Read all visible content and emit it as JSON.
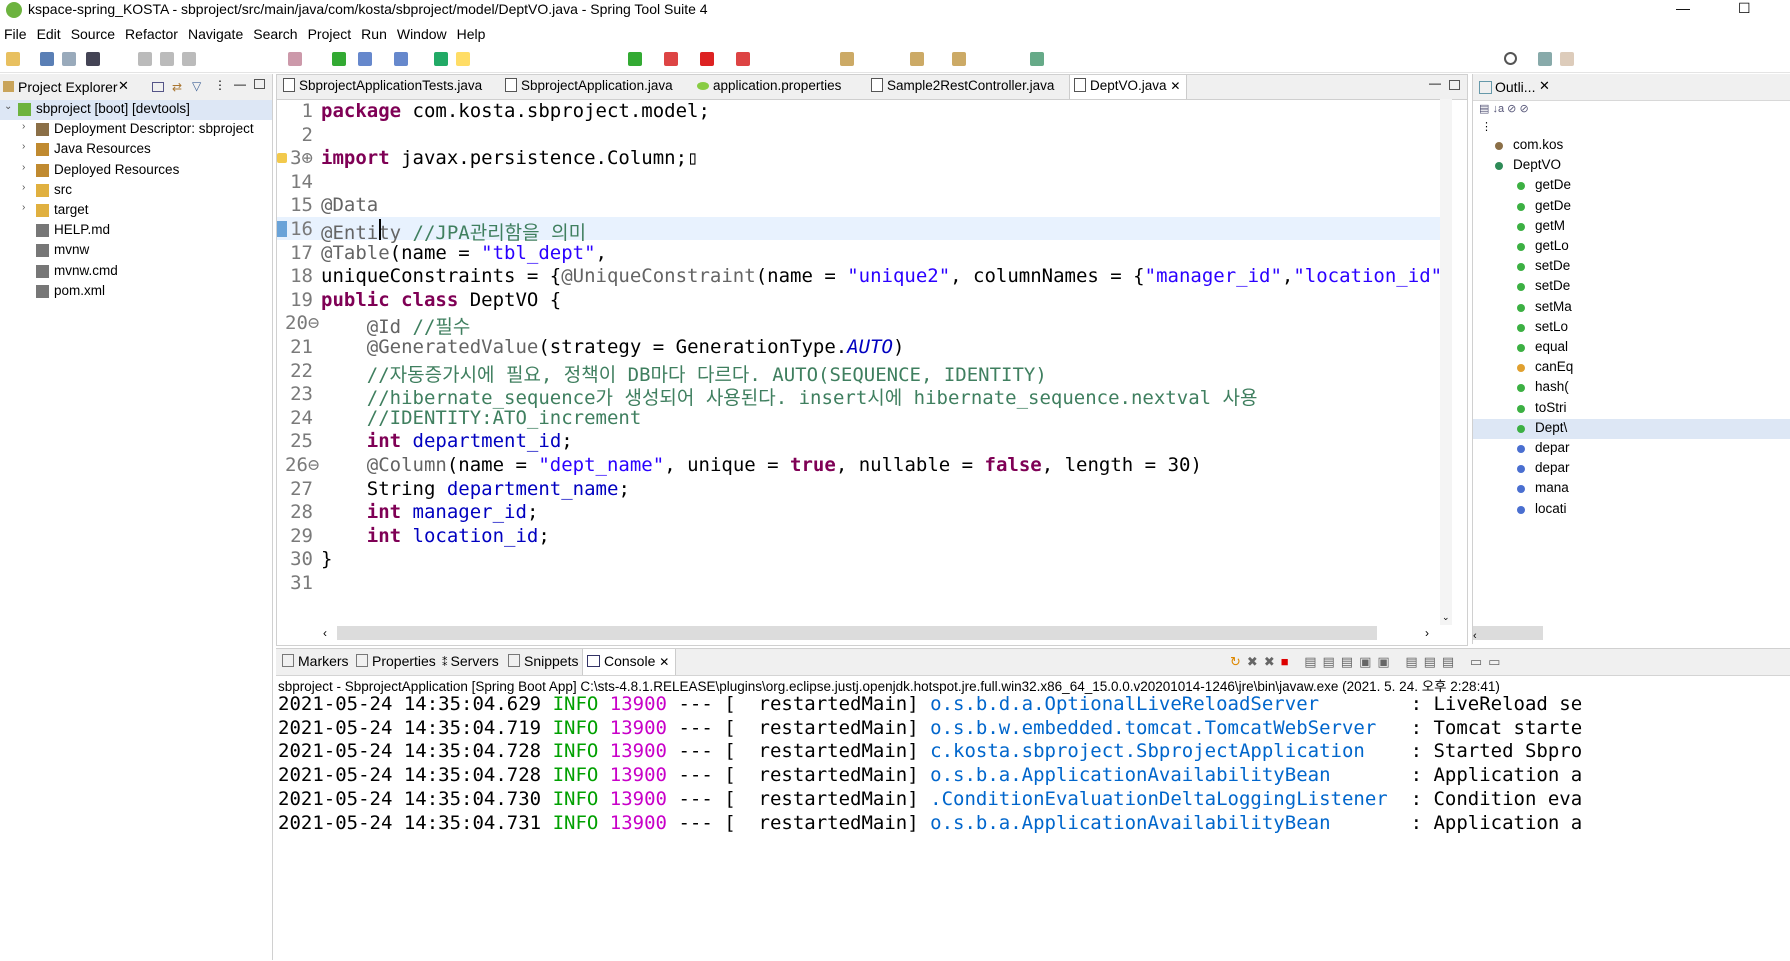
{
  "window": {
    "title": "kspace-spring_KOSTA - sbproject/src/main/java/com/kosta/sbproject/model/DeptVO.java - Spring Tool Suite 4",
    "minimize": "—",
    "maximize": "☐"
  },
  "menu": [
    "File",
    "Edit",
    "Source",
    "Refactor",
    "Navigate",
    "Search",
    "Project",
    "Run",
    "Window",
    "Help"
  ],
  "explorer": {
    "title": "Project Explorer",
    "items": [
      {
        "label": "sbproject [boot] [devtools]",
        "expand": "⌄",
        "color": "#6db33f"
      },
      {
        "label": "Deployment Descriptor: sbproject",
        "expand": "›",
        "color": "#8b6f47"
      },
      {
        "label": "Java Resources",
        "expand": "›",
        "color": "#c08a30"
      },
      {
        "label": "Deployed Resources",
        "expand": "›",
        "color": "#c08a30"
      },
      {
        "label": "src",
        "expand": "›",
        "color": "#e0b040"
      },
      {
        "label": "target",
        "expand": "›",
        "color": "#e0b040"
      },
      {
        "label": "HELP.md",
        "expand": "",
        "color": "#777777"
      },
      {
        "label": "mvnw",
        "expand": "",
        "color": "#777777"
      },
      {
        "label": "mvnw.cmd",
        "expand": "",
        "color": "#777777"
      },
      {
        "label": "pom.xml",
        "expand": "",
        "color": "#777777"
      }
    ]
  },
  "editor": {
    "tabs": [
      {
        "label": "SbprojectApplicationTests.java"
      },
      {
        "label": "SbprojectApplication.java"
      },
      {
        "label": "application.properties"
      },
      {
        "label": "Sample2RestController.java"
      },
      {
        "label": "DeptVO.java"
      }
    ],
    "active_tab_close": "✕",
    "lines": [
      {
        "n": "1",
        "code": "<span class='kw'>package</span> com.kosta.sbproject.model;"
      },
      {
        "n": "2",
        "code": ""
      },
      {
        "n": "3⊕",
        "code": "<span class='kw'>import</span> javax.persistence.Column;▯"
      },
      {
        "n": "14",
        "code": ""
      },
      {
        "n": "15",
        "code": "<span class='an'>@Data</span>"
      },
      {
        "n": "16",
        "code": "<span class='an'>@Entity</span> <span class='cm'>//JPA관리함을 의미</span>"
      },
      {
        "n": "17",
        "code": "<span class='an'>@Table</span>(name = <span class='st'>\"tbl_dept\"</span>,"
      },
      {
        "n": "18",
        "code": "uniqueConstraints = {<span class='an'>@UniqueConstraint</span>(name = <span class='st'>\"unique2\"</span>, columnNames = {<span class='st'>\"manager_id\"</span>,<span class='st'>\"location_id\"</span>"
      },
      {
        "n": "19",
        "code": "<span class='kw'>public</span> <span class='kw'>class</span> DeptVO {"
      },
      {
        "n": "20⊖",
        "code": "    <span class='an'>@Id</span> <span class='cm'>//필수</span>"
      },
      {
        "n": "21",
        "code": "    <span class='an'>@GeneratedValue</span>(strategy = GenerationType.<span class='it'>AUTO</span>)"
      },
      {
        "n": "22",
        "code": "    <span class='cm'>//자동증가시에 필요, 정책이 DB마다 다르다. AUTO(SEQUENCE, IDENTITY)</span>"
      },
      {
        "n": "23",
        "code": "    <span class='cm'>//hibernate_sequence가 생성되어 사용된다. insert시에 hibernate_sequence.nextval 사용</span>"
      },
      {
        "n": "24",
        "code": "    <span class='cm'>//IDENTITY:ATO_increment</span>"
      },
      {
        "n": "25",
        "code": "    <span class='kw'>int</span> <span class='fd'>department_id</span>;"
      },
      {
        "n": "26⊖",
        "code": "    <span class='an'>@Column</span>(name = <span class='st'>\"dept_name\"</span>, unique = <span class='kw'>true</span>, nullable = <span class='kw'>false</span>, length = 30)"
      },
      {
        "n": "27",
        "code": "    String <span class='fd'>department_name</span>;"
      },
      {
        "n": "28",
        "code": "    <span class='kw'>int</span> <span class='fd'>manager_id</span>;"
      },
      {
        "n": "29",
        "code": "    <span class='kw'>int</span> <span class='fd'>location_id</span>;"
      },
      {
        "n": "30",
        "code": "}"
      },
      {
        "n": "31",
        "code": ""
      }
    ]
  },
  "outline": {
    "title": "Outli...",
    "items": [
      {
        "label": "com.kos",
        "color": "#8b6f47"
      },
      {
        "label": "DeptVO",
        "color": "#2e8b57"
      },
      {
        "label": "getDe",
        "color": "#3cb043"
      },
      {
        "label": "getDe",
        "color": "#3cb043"
      },
      {
        "label": "getM",
        "color": "#3cb043"
      },
      {
        "label": "getLo",
        "color": "#3cb043"
      },
      {
        "label": "setDe",
        "color": "#3cb043"
      },
      {
        "label": "setDe",
        "color": "#3cb043"
      },
      {
        "label": "setMa",
        "color": "#3cb043"
      },
      {
        "label": "setLo",
        "color": "#3cb043"
      },
      {
        "label": "equal",
        "color": "#3cb043"
      },
      {
        "label": "canEq",
        "color": "#e0a030"
      },
      {
        "label": "hash(",
        "color": "#3cb043"
      },
      {
        "label": "toStri",
        "color": "#3cb043"
      },
      {
        "label": "Dept\\",
        "color": "#3cb043"
      },
      {
        "label": "depar",
        "color": "#4a6fd0"
      },
      {
        "label": "depar",
        "color": "#4a6fd0"
      },
      {
        "label": "mana",
        "color": "#4a6fd0"
      },
      {
        "label": "locati",
        "color": "#4a6fd0"
      }
    ]
  },
  "console": {
    "tabs": [
      "Markers",
      "Properties",
      "Servers",
      "Snippets",
      "Console"
    ],
    "info": "sbproject - SbprojectApplication [Spring Boot App] C:\\sts-4.8.1.RELEASE\\plugins\\org.eclipse.justj.openjdk.hotspot.jre.full.win32.x86_64_15.0.0.v20201014-1246\\jre\\bin\\javaw.exe  (2021. 5. 24. 오후 2:28:41)",
    "lines": [
      {
        "ts": "2021-05-24 14:35:04.629",
        "lvl": "INFO",
        "pid": "13900",
        "sep": "---",
        "thr": "[  restartedMain]",
        "cls": "o.s.b.d.a.OptionalLiveReloadServer       ",
        "msg": ": LiveReload se"
      },
      {
        "ts": "2021-05-24 14:35:04.719",
        "lvl": "INFO",
        "pid": "13900",
        "sep": "---",
        "thr": "[  restartedMain]",
        "cls": "o.s.b.w.embedded.tomcat.TomcatWebServer  ",
        "msg": ": Tomcat starte"
      },
      {
        "ts": "2021-05-24 14:35:04.728",
        "lvl": "INFO",
        "pid": "13900",
        "sep": "---",
        "thr": "[  restartedMain]",
        "cls": "c.kosta.sbproject.SbprojectApplication   ",
        "msg": ": Started Sbpro"
      },
      {
        "ts": "2021-05-24 14:35:04.728",
        "lvl": "INFO",
        "pid": "13900",
        "sep": "---",
        "thr": "[  restartedMain]",
        "cls": "o.s.b.a.ApplicationAvailabilityBean      ",
        "msg": ": Application a"
      },
      {
        "ts": "2021-05-24 14:35:04.730",
        "lvl": "INFO",
        "pid": "13900",
        "sep": "---",
        "thr": "[  restartedMain]",
        "cls": ".ConditionEvaluationDeltaLoggingListener ",
        "msg": ": Condition eva"
      },
      {
        "ts": "2021-05-24 14:35:04.731",
        "lvl": "INFO",
        "pid": "13900",
        "sep": "---",
        "thr": "[  restartedMain]",
        "cls": "o.s.b.a.ApplicationAvailabilityBean      ",
        "msg": ": Application a"
      }
    ]
  }
}
